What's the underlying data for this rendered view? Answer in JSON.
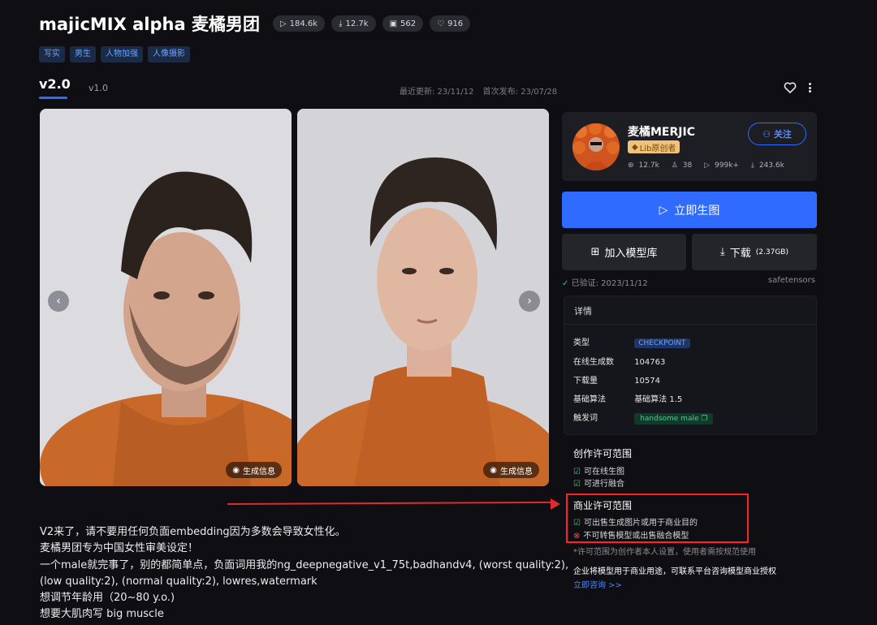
{
  "header": {
    "title": "majicMIX alpha 麦橘男团",
    "stats": [
      {
        "icon": "play-icon",
        "value": "184.6k"
      },
      {
        "icon": "download-icon",
        "value": "12.7k"
      },
      {
        "icon": "image-icon",
        "value": "562"
      },
      {
        "icon": "heart-icon",
        "value": "916"
      }
    ],
    "tags": [
      "写实",
      "男生",
      "人物加强",
      "人像摄影"
    ]
  },
  "versions": {
    "active": "v2.0",
    "other": "v1.0",
    "updated": "最近更新: 23/11/12",
    "published": "首次发布: 23/07/28"
  },
  "gallery": {
    "gen_info_label": "生成信息"
  },
  "creator": {
    "name": "麦橘MERJIC",
    "badge": "Lib原创者",
    "follow_label": "关注",
    "stats": [
      {
        "icon": "fans-icon",
        "value": "12.7k"
      },
      {
        "icon": "thumb-icon",
        "value": "38"
      },
      {
        "icon": "play-icon",
        "value": "999k+"
      },
      {
        "icon": "download-icon",
        "value": "243.6k"
      }
    ]
  },
  "actions": {
    "generate": "立即生图",
    "add_library": "加入模型库",
    "download": "下载",
    "download_size": "(2.37GB)"
  },
  "verify": {
    "text": "已验证: 2023/11/12",
    "format": "safetensors"
  },
  "details": {
    "title": "详情",
    "rows": [
      {
        "key": "类型",
        "value": "CHECKPOINT"
      },
      {
        "key": "在线生成数",
        "value": "104763"
      },
      {
        "key": "下载量",
        "value": "10574"
      },
      {
        "key": "基础算法",
        "value": "基础算法 1.5"
      },
      {
        "key": "触发词",
        "value": "handsome male"
      }
    ]
  },
  "license": {
    "creation_title": "创作许可范围",
    "creation_items": [
      "可在线生图",
      "可进行融合"
    ],
    "commercial_title": "商业许可范围",
    "commercial_allowed": "可出售生成图片或用于商业目的",
    "commercial_denied": "不可转售模型或出售融合模型",
    "note": "*许可范围为创作者本人设置，使用者需按规范使用",
    "enterprise": "企业将模型用于商业用途，可联系平台咨询模型商业授权",
    "consult": "立即咨询 >>"
  },
  "description": [
    "V2来了，请不要用任何负面embedding因为多数会导致女性化。",
    "麦橘男团专为中国女性审美设定！",
    "一个male就完事了，别的都简单点，负面词用我的ng_deepnegative_v1_75t,badhandv4, (worst quality:2),",
    "(low quality:2), (normal quality:2), lowres,watermark",
    "想调节年龄用（20~80 y.o.)",
    "想要大肌肉写 big muscle"
  ],
  "colors": {
    "background": "#0f0f13",
    "accent": "#2f6bff",
    "highlight": "#ff2222",
    "success": "#3fbf7f"
  }
}
